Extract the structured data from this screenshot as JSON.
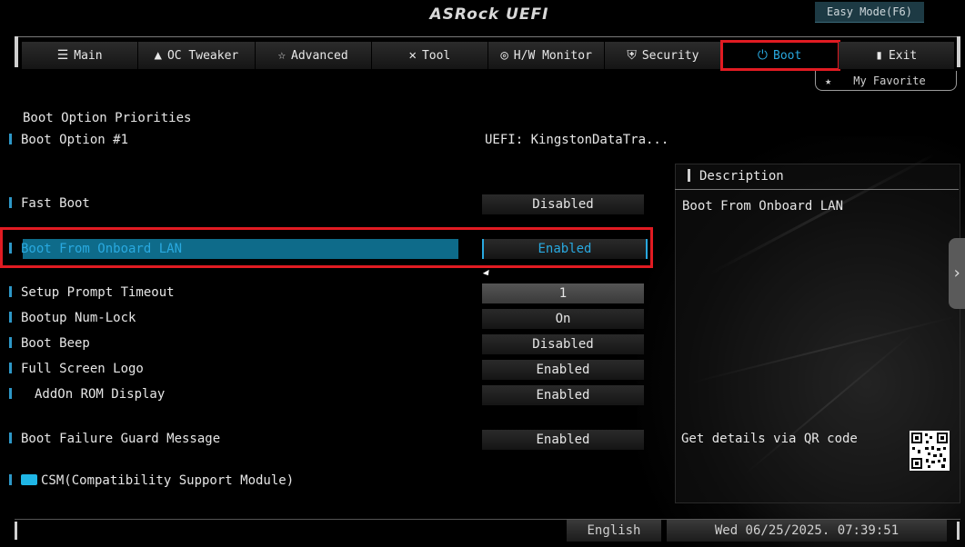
{
  "header": {
    "logo": "ASRock UEFI",
    "easy_mode": "Easy Mode(F6)",
    "my_favorite": "My Favorite"
  },
  "tabs": [
    {
      "label": "Main",
      "icon": "list-icon"
    },
    {
      "label": "OC Tweaker",
      "icon": "rocket-icon"
    },
    {
      "label": "Advanced",
      "icon": "star-icon"
    },
    {
      "label": "Tool",
      "icon": "tools-icon"
    },
    {
      "label": "H/W Monitor",
      "icon": "monitor-icon"
    },
    {
      "label": "Security",
      "icon": "shield-icon"
    },
    {
      "label": "Boot",
      "icon": "power-icon",
      "active": true
    },
    {
      "label": "Exit",
      "icon": "exit-door-icon"
    }
  ],
  "settings": {
    "section_title": "Boot Option Priorities",
    "boot_option_1": {
      "label": "Boot Option #1",
      "value": "UEFI: KingstonDataTra..."
    },
    "fast_boot": {
      "label": "Fast Boot",
      "value": "Disabled"
    },
    "boot_from_lan": {
      "label": "Boot From Onboard LAN",
      "value": "Enabled"
    },
    "setup_prompt_timeout": {
      "label": "Setup Prompt Timeout",
      "value": "1"
    },
    "bootup_numlock": {
      "label": "Bootup Num-Lock",
      "value": "On"
    },
    "boot_beep": {
      "label": "Boot Beep",
      "value": "Disabled"
    },
    "full_screen_logo": {
      "label": "Full Screen Logo",
      "value": "Enabled"
    },
    "addon_rom_display": {
      "label": "AddOn ROM Display",
      "value": "Enabled"
    },
    "boot_failure_guard": {
      "label": "Boot Failure Guard Message",
      "value": "Enabled"
    },
    "csm": {
      "label": "CSM(Compatibility Support Module)"
    }
  },
  "description": {
    "title": "Description",
    "text": "Boot From Onboard LAN",
    "qr_text": "Get details via QR code"
  },
  "footer": {
    "language": "English",
    "datetime": "Wed 06/25/2025. 07:39:51"
  },
  "colors": {
    "accent": "#29a9e0",
    "selection": "#0e6b8a",
    "highlight_outline": "#e11b22"
  }
}
